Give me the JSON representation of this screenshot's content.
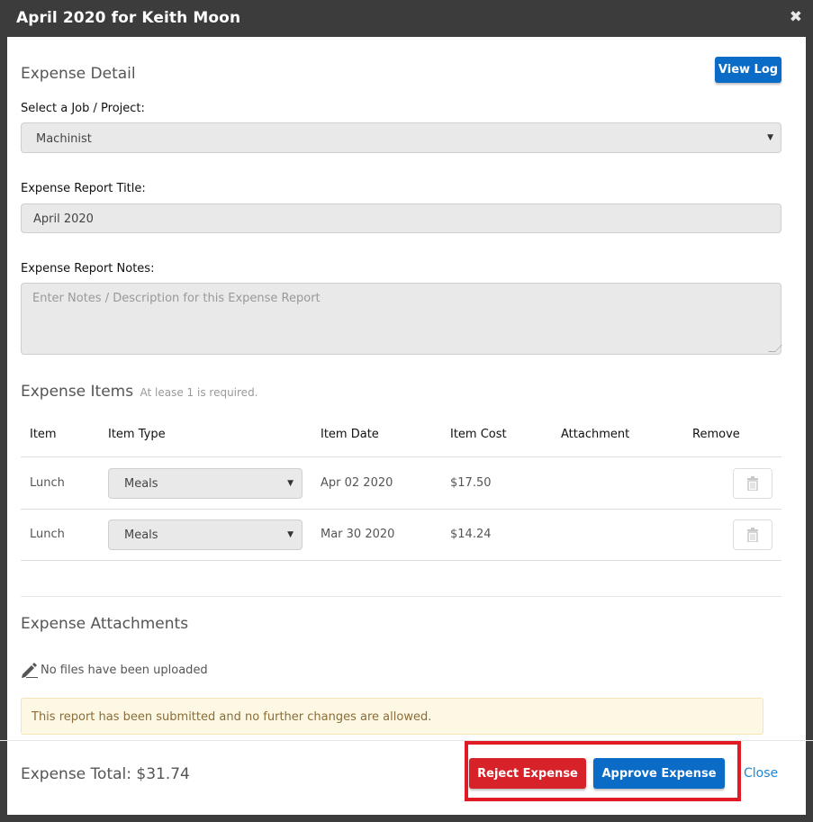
{
  "modal": {
    "title": "April 2020 for Keith Moon",
    "close_icon": "✖"
  },
  "detail": {
    "section_title": "Expense Detail",
    "view_log_label": "View Log",
    "job_label": "Select a Job / Project:",
    "job_value": "Machinist",
    "title_label": "Expense Report Title:",
    "title_value": "April 2020",
    "notes_label": "Expense Report Notes:",
    "notes_placeholder": "Enter Notes / Description for this Expense Report"
  },
  "items": {
    "section_title": "Expense Items",
    "hint": "At lease 1 is required.",
    "columns": [
      "Item",
      "Item Type",
      "Item Date",
      "Item Cost",
      "Attachment",
      "Remove"
    ],
    "rows": [
      {
        "item": "Lunch",
        "type": "Meals",
        "date": "Apr 02 2020",
        "cost": "$17.50"
      },
      {
        "item": "Lunch",
        "type": "Meals",
        "date": "Mar 30 2020",
        "cost": "$14.24"
      }
    ]
  },
  "attachments": {
    "section_title": "Expense Attachments",
    "empty_text": "No files have been uploaded"
  },
  "alert": {
    "text": "This report has been submitted and no further changes are allowed."
  },
  "footer": {
    "total": "Expense Total: $31.74",
    "reject_label": "Reject Expense",
    "approve_label": "Approve Expense",
    "close_label": "Close"
  },
  "colors": {
    "header": "#3c3c3c",
    "primary": "#0b6cc7",
    "danger": "#d82229",
    "highlight": "#e01b24"
  }
}
